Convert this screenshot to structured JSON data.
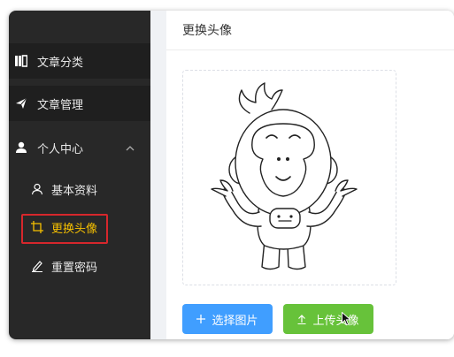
{
  "sidebar": {
    "items": [
      {
        "label": "文章分类",
        "icon": "book-icon"
      },
      {
        "label": "文章管理",
        "icon": "send-icon"
      },
      {
        "label": "个人中心",
        "icon": "user-icon"
      }
    ],
    "sub_items": [
      {
        "label": "基本资料",
        "icon": "user-outline-icon"
      },
      {
        "label": "更换头像",
        "icon": "crop-icon"
      },
      {
        "label": "重置密码",
        "icon": "edit-icon"
      }
    ]
  },
  "main": {
    "title": "更换头像",
    "select_button": "选择图片",
    "upload_button": "上传头像"
  },
  "colors": {
    "sidebar_bg": "#282828",
    "active_text": "#f6c000",
    "highlight_border": "#d6272c",
    "primary": "#409eff",
    "success": "#67c23a"
  }
}
